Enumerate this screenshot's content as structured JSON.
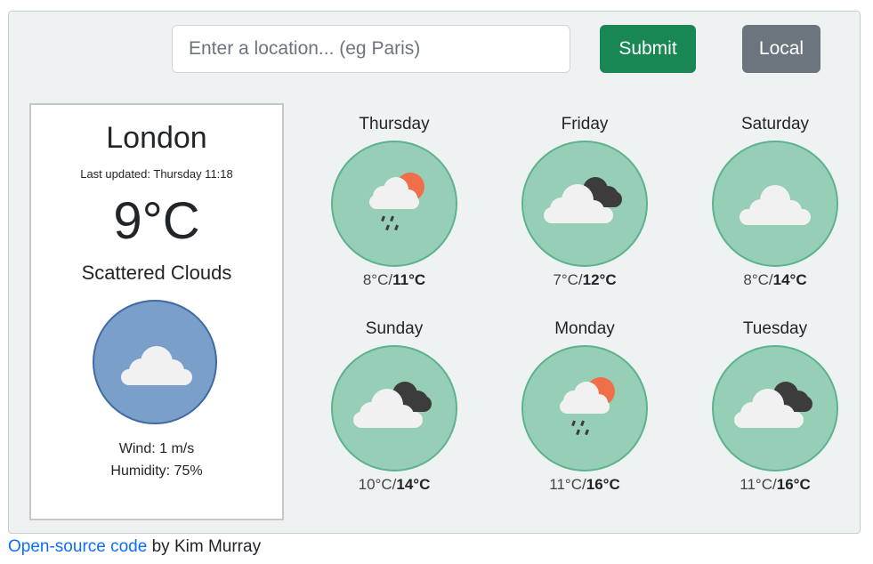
{
  "search": {
    "placeholder": "Enter a location... (eg Paris)",
    "value": ""
  },
  "buttons": {
    "submit": "Submit",
    "local": "Local"
  },
  "current": {
    "city": "London",
    "last_updated": "Last updated: Thursday 11:18",
    "temperature": "9°C",
    "description": "Scattered Clouds",
    "icon": "cloud-icon",
    "wind": "Wind: 1 m/s",
    "humidity": "Humidity: 75%"
  },
  "forecast": [
    {
      "day": "Thursday",
      "icon": "sun-cloud-rain-icon",
      "low": "8°C",
      "high": "11°C"
    },
    {
      "day": "Friday",
      "icon": "dark-cloud-icon",
      "low": "7°C",
      "high": "12°C"
    },
    {
      "day": "Saturday",
      "icon": "cloud-icon",
      "low": "8°C",
      "high": "14°C"
    },
    {
      "day": "Sunday",
      "icon": "dark-cloud-icon",
      "low": "10°C",
      "high": "14°C"
    },
    {
      "day": "Monday",
      "icon": "sun-cloud-rain-icon",
      "low": "11°C",
      "high": "16°C"
    },
    {
      "day": "Tuesday",
      "icon": "dark-cloud-icon",
      "low": "11°C",
      "high": "16°C"
    }
  ],
  "footer": {
    "link_text": "Open-source code",
    "suffix": " by Kim Murray"
  },
  "colors": {
    "forecast_circle": "#96cfb6",
    "forecast_border": "#5cb38d",
    "current_circle": "#7a9fc9",
    "current_border": "#3f6aa6",
    "sun": "#ef6f4a",
    "dark_cloud": "#3c3c3c",
    "cloud": "#f1f1f1"
  }
}
